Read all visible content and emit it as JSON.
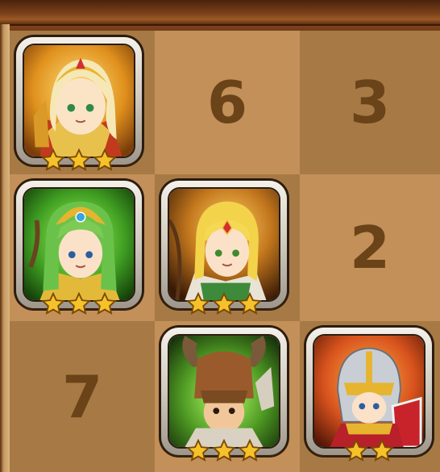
{
  "board": {
    "cells": [
      {
        "id": "r1c1",
        "type": "hero",
        "hero": "golden-paladin-heroine",
        "stars": 3,
        "bg": "#e3a52c"
      },
      {
        "id": "r1c2",
        "type": "number",
        "value": "6"
      },
      {
        "id": "r1c3",
        "type": "number",
        "value": "3"
      },
      {
        "id": "r2c1",
        "type": "hero",
        "hero": "green-elf-heroine",
        "stars": 3,
        "bg": "#3f9d22"
      },
      {
        "id": "r2c2",
        "type": "hero",
        "hero": "blonde-ranger-heroine",
        "stars": 3,
        "bg": "#c4781d"
      },
      {
        "id": "r2c3",
        "type": "number",
        "value": "2"
      },
      {
        "id": "r3c1",
        "type": "number",
        "value": "7"
      },
      {
        "id": "r3c2",
        "type": "hero",
        "hero": "minotaur-warrior",
        "stars": 3,
        "bg": "#4f9a23"
      },
      {
        "id": "r3c3",
        "type": "hero",
        "hero": "red-armored-knight",
        "stars": 2,
        "bg": "#d8531d"
      }
    ]
  },
  "colors": {
    "cell_dark": "#a77a45",
    "cell_light": "#c29058",
    "number": "#6b4319",
    "star": "#f6c22a"
  }
}
